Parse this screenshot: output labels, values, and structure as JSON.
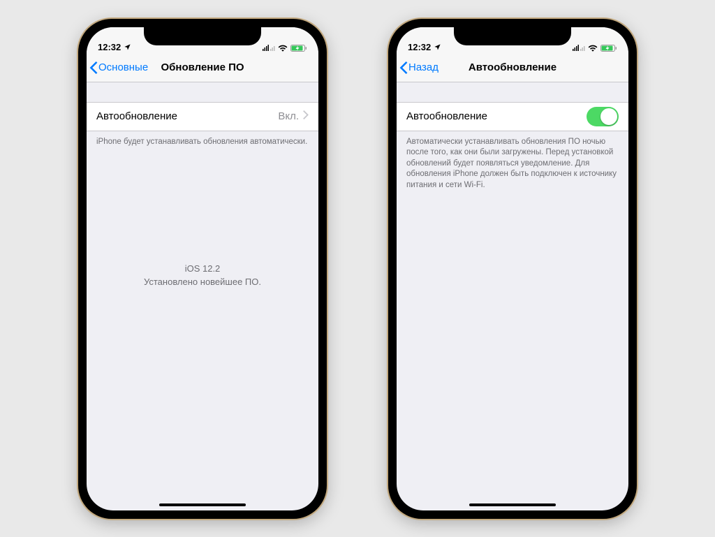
{
  "statusbar": {
    "time": "12:32"
  },
  "left": {
    "nav_back": "Основные",
    "nav_title": "Обновление ПО",
    "cell_label": "Автообновление",
    "cell_value": "Вкл.",
    "footer": "iPhone будет устанавливать обновления автоматически.",
    "center_line1": "iOS 12.2",
    "center_line2": "Установлено новейшее ПО."
  },
  "right": {
    "nav_back": "Назад",
    "nav_title": "Автообновление",
    "cell_label": "Автообновление",
    "toggle_on": true,
    "footer": "Автоматически устанавливать обновления ПО ночью после того, как они были загружены. Перед установкой обновлений будет появляться уведомление. Для обновления iPhone должен быть подключен к источнику питания и сети Wi-Fi."
  }
}
